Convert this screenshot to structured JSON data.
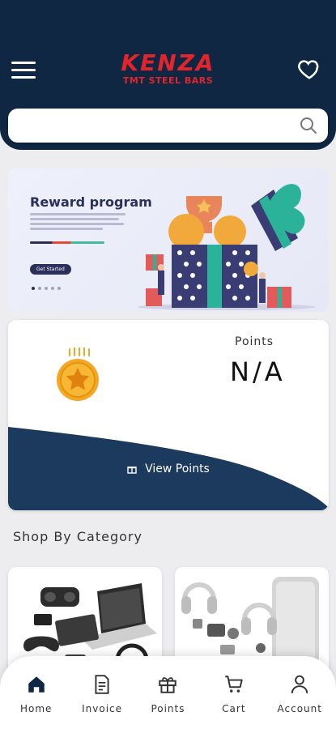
{
  "header": {
    "logo_main": "KENZA",
    "logo_sub": "TMT STEEL BARS"
  },
  "search": {
    "placeholder": ""
  },
  "banner": {
    "title": "Reward program",
    "button_label": "Get Started"
  },
  "points": {
    "label": "Points",
    "value": "N/A",
    "view_label": "View Points"
  },
  "category": {
    "title": "Shop By Category"
  },
  "nav": {
    "items": [
      {
        "label": "Home",
        "icon": "home-icon",
        "active": true
      },
      {
        "label": "Invoice",
        "icon": "invoice-icon"
      },
      {
        "label": "Points",
        "icon": "gift-icon"
      },
      {
        "label": "Cart",
        "icon": "cart-icon"
      },
      {
        "label": "Account",
        "icon": "user-icon"
      }
    ]
  },
  "colors": {
    "brand_navy": "#0f2742",
    "brand_red": "#e3242b",
    "card_navy": "#1c3a5e",
    "coin_gold": "#f5a623"
  }
}
